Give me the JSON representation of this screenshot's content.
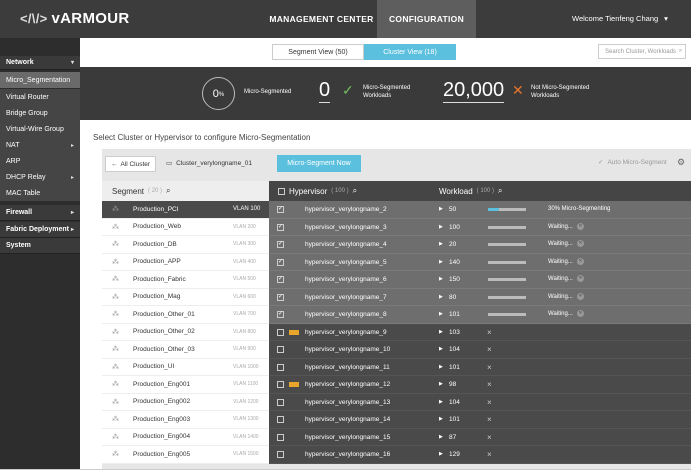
{
  "header": {
    "logo": "vARMOUR",
    "logo_mark": "</\\/>",
    "tab_mgmt": "MANAGEMENT CENTER",
    "tab_config": "CONFIGURATION",
    "welcome": "Welcome Tienfeng Chang"
  },
  "sidebar": [
    {
      "label": "Network",
      "type": "section",
      "chev": "▾"
    },
    {
      "label": "Micro_Segmentation",
      "type": "sub",
      "active": true
    },
    {
      "label": "Virtual Router",
      "type": "sub"
    },
    {
      "label": "Bridge Group",
      "type": "sub"
    },
    {
      "label": "Virtual-Wire Group",
      "type": "sub"
    },
    {
      "label": "NAT",
      "type": "sub",
      "chev": "▸"
    },
    {
      "label": "ARP",
      "type": "sub"
    },
    {
      "label": "DHCP Relay",
      "type": "sub",
      "chev": "▸"
    },
    {
      "label": "MAC Table",
      "type": "sub"
    },
    {
      "label": "Firewall",
      "type": "section",
      "chev": "▸"
    },
    {
      "label": "Fabric Deployment",
      "type": "section",
      "chev": "▸"
    },
    {
      "label": "System",
      "type": "section"
    }
  ],
  "views": {
    "segment": "Segment View (50)",
    "cluster": "Cluster View (18)"
  },
  "search": {
    "placeholder": "Search Cluster, Workloads"
  },
  "stats": {
    "pct": "0",
    "pct_unit": "%",
    "pct_label": "Micro-Segmented",
    "seg_count": "0",
    "seg_label_1": "Micro-Segmented",
    "seg_label_2": "Workloads",
    "notseg_count": "20,000",
    "notseg_label_1": "Not Micro-Segmented",
    "notseg_label_2": "Workloads"
  },
  "instruction": "Select Cluster or Hypervisor to configure Micro-Segmentation",
  "toolbar": {
    "all_cluster": "All Cluster",
    "cluster_name": "Cluster_verylongname_01",
    "microseg_now": "Micro-Segment Now",
    "auto_micro": "Auto Micro-Segment"
  },
  "columns": {
    "segment": "Segment",
    "segment_count": "( 20 )",
    "hypervisor": "Hypervisor",
    "hypervisor_count": "( 100 )",
    "workload": "Workload",
    "workload_count": "( 100 )"
  },
  "segments": [
    {
      "name": "Production_PCI",
      "vlan": "VLAN 100",
      "selected": true
    },
    {
      "name": "Production_Web",
      "vlan": "VLAN 200"
    },
    {
      "name": "Production_DB",
      "vlan": "VLAN 300"
    },
    {
      "name": "Production_APP",
      "vlan": "VLAN 400"
    },
    {
      "name": "Production_Fabric",
      "vlan": "VLAN 500"
    },
    {
      "name": "Production_Mag",
      "vlan": "VLAN 600"
    },
    {
      "name": "Production_Other_01",
      "vlan": "VLAN 700"
    },
    {
      "name": "Production_Other_02",
      "vlan": "VLAN 800"
    },
    {
      "name": "Production_Other_03",
      "vlan": "VLAN 900"
    },
    {
      "name": "Production_UI",
      "vlan": "VLAN 1000"
    },
    {
      "name": "Production_Eng001",
      "vlan": "VLAN 1100"
    },
    {
      "name": "Production_Eng002",
      "vlan": "VLAN 1200"
    },
    {
      "name": "Production_Eng003",
      "vlan": "VLAN 1300"
    },
    {
      "name": "Production_Eng004",
      "vlan": "VLAN 1400"
    },
    {
      "name": "Production_Eng005",
      "vlan": "VLAN 1500"
    }
  ],
  "hypervisors": [
    {
      "name": "hypervisor_verylongname_2",
      "workload": "50",
      "checked": true,
      "progress": 0.3,
      "status": "30%  Micro-Segmenting"
    },
    {
      "name": "hypervisor_verylongname_3",
      "workload": "100",
      "checked": true,
      "progress": 0,
      "status": "Waiting..."
    },
    {
      "name": "hypervisor_verylongname_4",
      "workload": "20",
      "checked": true,
      "progress": 0,
      "status": "Waiting..."
    },
    {
      "name": "hypervisor_verylongname_5",
      "workload": "140",
      "checked": true,
      "progress": 0,
      "status": "Waiting..."
    },
    {
      "name": "hypervisor_verylongname_6",
      "workload": "150",
      "checked": true,
      "progress": 0,
      "status": "Waiting..."
    },
    {
      "name": "hypervisor_verylongname_7",
      "workload": "80",
      "checked": true,
      "progress": 0,
      "status": "Waiting..."
    },
    {
      "name": "hypervisor_verylongname_8",
      "workload": "101",
      "checked": true,
      "progress": 0,
      "status": "Waiting..."
    },
    {
      "name": "hypervisor_verylongname_9",
      "workload": "103",
      "tag": true
    },
    {
      "name": "hypervisor_verylongname_10",
      "workload": "104"
    },
    {
      "name": "hypervisor_verylongname_11",
      "workload": "101"
    },
    {
      "name": "hypervisor_verylongname_12",
      "workload": "98",
      "tag": true
    },
    {
      "name": "hypervisor_verylongname_13",
      "workload": "104"
    },
    {
      "name": "hypervisor_verylongname_14",
      "workload": "101"
    },
    {
      "name": "hypervisor_verylongname_15",
      "workload": "87"
    },
    {
      "name": "hypervisor_verylongname_16",
      "workload": "129"
    }
  ],
  "colors": {
    "accent": "#5bc0de",
    "check": "#6fbf5f",
    "cross": "#e8732b",
    "tag": "#e8a52b"
  }
}
